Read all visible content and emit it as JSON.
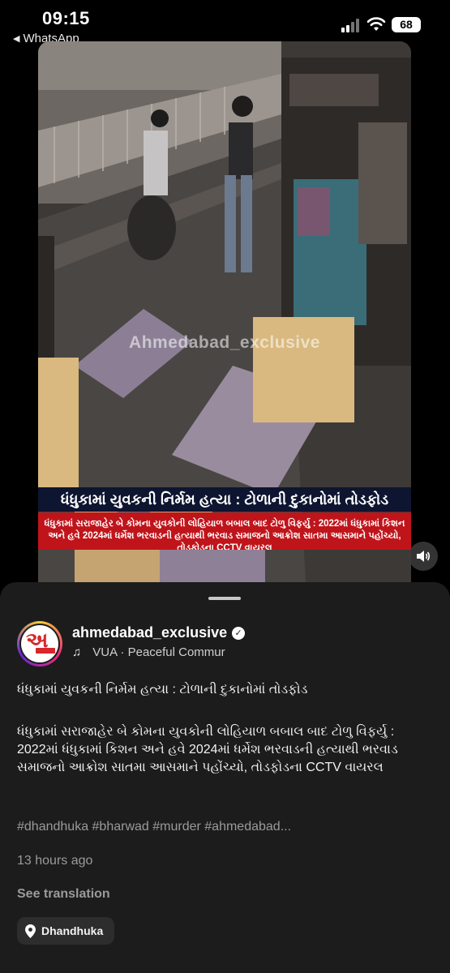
{
  "status_bar": {
    "time": "09:15",
    "back_app": "WhatsApp",
    "battery": "68"
  },
  "video": {
    "watermark": "Ahmedabad_exclusive",
    "headline": "ધંધુકામાં યુવકની નિર્મમ હત્યા : ટોળાની દુકાનોમાં તોડફોડ",
    "subheadline": "ધંધુકામાં સરાજાહેર બે કોમના યુવકોની લોહિયાળ બબાલ બાદ ટોળુ વિફર્યુ : 2022માં ધંધુકામાં કિશન અને હવે 2024માં ધર્મેશ ભરવાડની હત્યાથી ભરવાડ સમાજનો આક્રોશ સાતમા આસમાને પહોંચ્યો, તોડફોડના CCTV વાયરલ",
    "headline_bg": "#0e1530",
    "subheadline_bg": "#c0141b"
  },
  "post": {
    "username": "ahmedabad_exclusive",
    "music": "VUA · Peaceful Commur",
    "caption_title": "ધંધુકામાં યુવકની નિર્મમ હત્યા : ટોળાની દુકાનોમાં તોડફોડ",
    "caption_body": "ધંધુકામાં સરાજાહેર બે કોમના યુવકોની લોહિયાળ બબાલ બાદ ટોળુ વિફર્યુ : 2022માં ધંધુકામાં કિશન અને હવે 2024માં ધર્મેશ ભરવાડની હત્યાથી ભરવાડ સમાજનો આક્રોશ સાતમા આસમાને પહોંચ્યો, તોડફોડના CCTV વાયરલ",
    "hashtags": "#dhandhuka #bharwad #murder #ahmedabad...",
    "posted_ago": "13 hours ago",
    "see_translation": "See translation",
    "location": "Dhandhuka"
  }
}
